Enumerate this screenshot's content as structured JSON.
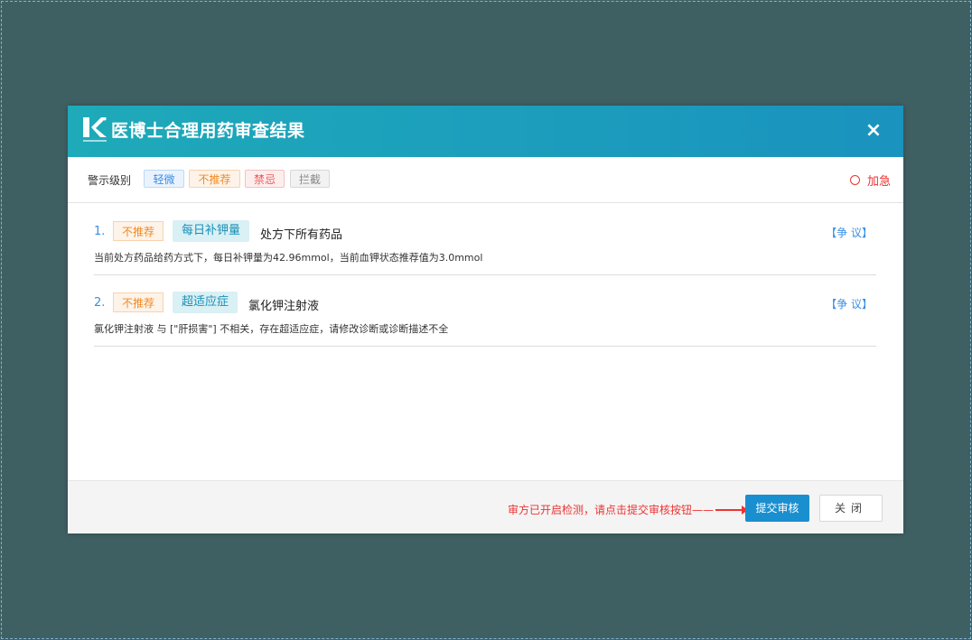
{
  "dialog": {
    "title": "医博士合理用药审查结果",
    "close_symbol": "×",
    "logo_icon": "k-logo"
  },
  "levels": {
    "label": "警示级别",
    "items": [
      "轻微",
      "不推荐",
      "禁忌",
      "拦截"
    ],
    "urgent_label": "加急"
  },
  "issues": [
    {
      "num": "1.",
      "level": "不推荐",
      "type": "每日补钾量",
      "drug": "处方下所有药品",
      "desc": "当前处方药品给药方式下，每日补钾量为42.96mmol，当前血钾状态推荐值为3.0mmol",
      "dispute": "【争 议】"
    },
    {
      "num": "2.",
      "level": "不推荐",
      "type": "超适应症",
      "drug": "氯化钾注射液",
      "desc": "氯化钾注射液 与 [\"肝损害\"] 不相关，存在超适应症，请修改诊断或诊断描述不全",
      "dispute": "【争 议】"
    }
  ],
  "footer": {
    "hint": "审方已开启检测，请点击提交审核按钮——",
    "submit_label": "提交审核",
    "close_label": "关闭"
  },
  "colors": {
    "backdrop": "#3f6063",
    "header_start": "#1eaab9",
    "header_end": "#1a93bf",
    "accent_blue": "#3a8ee6",
    "warning_orange": "#f08a24",
    "danger_red": "#e33"
  }
}
